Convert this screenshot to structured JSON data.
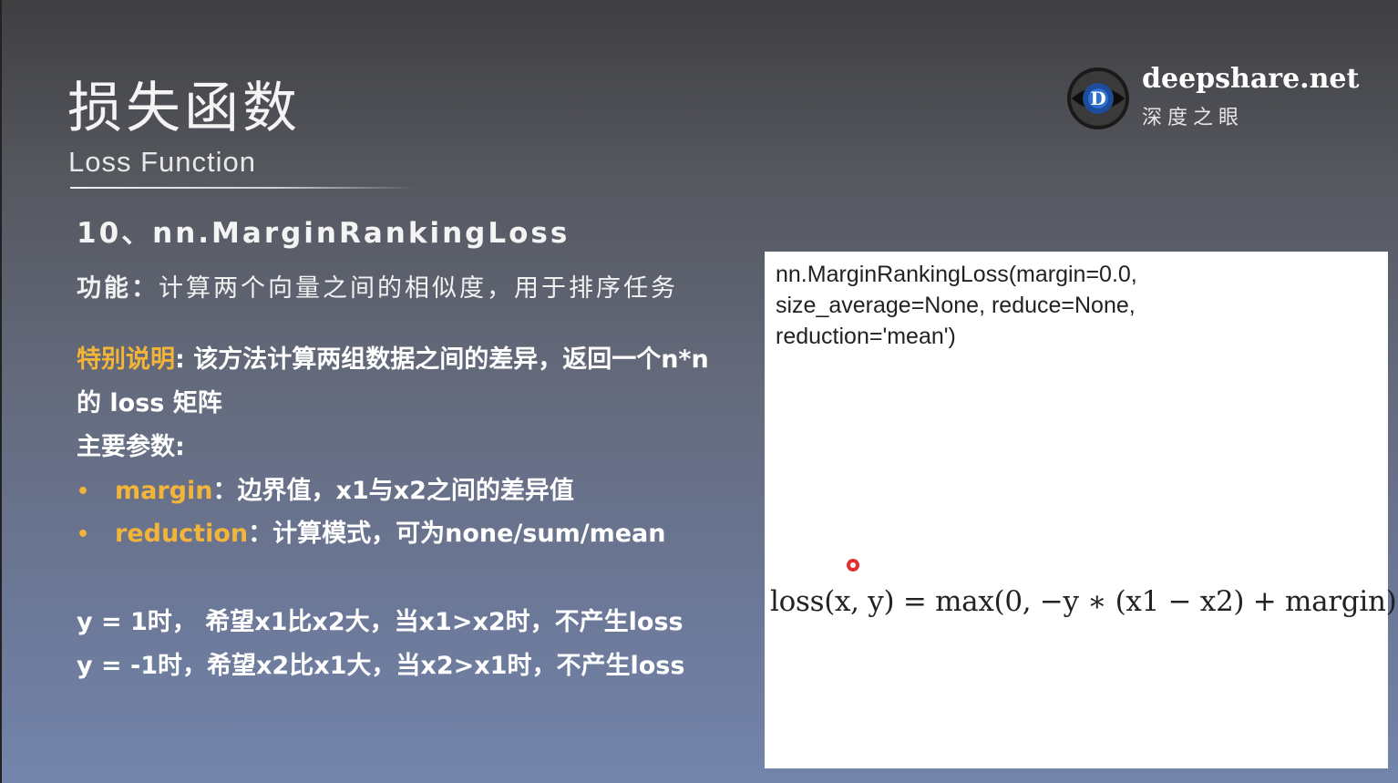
{
  "slide": {
    "title": "损失函数",
    "subtitle": "Loss Function",
    "section": "10、nn.MarginRankingLoss",
    "function_label": "功能：",
    "function_text": "计算两个向量之间的相似度，用于排序任务",
    "special_label": "特别说明",
    "special_text": ": 该方法计算两组数据之间的差异，返回一个n*n",
    "special_text_2": "的 loss 矩阵",
    "params_label": "主要参数:",
    "params": [
      {
        "name": "margin",
        "desc": "：边界值，x1与x2之间的差异值"
      },
      {
        "name": "reduction",
        "desc": "：计算模式，可为none/sum/mean"
      }
    ],
    "rule_1": "y = 1时， 希望x1比x2大，当x1>x2时，不产生loss",
    "rule_2": "y = -1时，希望x2比x1大，当x2>x1时，不产生loss"
  },
  "brand": {
    "name": "deepshare.net",
    "cn": "深度之眼",
    "logo_icon": "eye-logo-icon"
  },
  "panel": {
    "code": "nn.MarginRankingLoss(margin=0.0,\nsize_average=None, reduce=None,\nreduction='mean')",
    "formula": "loss(x, y) = max(0, −y ∗ (x1 − x2) + margin)"
  },
  "colors": {
    "accent": "#f3b43a",
    "panel_bg": "#ffffff",
    "cursor": "#e03030"
  }
}
